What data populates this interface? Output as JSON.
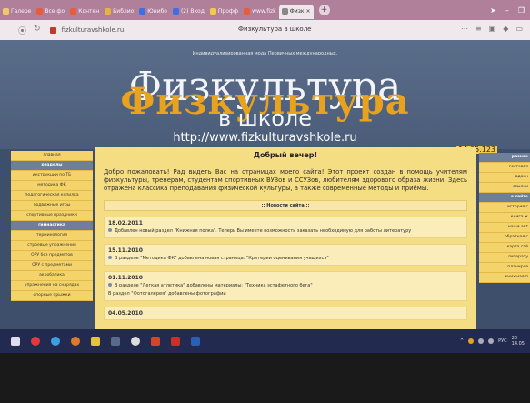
{
  "browser": {
    "tabs": [
      {
        "label": "Галере",
        "active": false
      },
      {
        "label": "Все фо",
        "active": false
      },
      {
        "label": "Контен",
        "active": false
      },
      {
        "label": "Библио",
        "active": false
      },
      {
        "label": "Юнибо",
        "active": false
      },
      {
        "label": "(2) Вход",
        "active": false
      },
      {
        "label": "Профф",
        "active": false
      },
      {
        "label": "www.fizk",
        "active": false
      },
      {
        "label": "Физк",
        "active": true
      }
    ],
    "new_tab": "+",
    "address": "fizkulturavshkole.ru",
    "page_title": "Физкультура в школе"
  },
  "site": {
    "top_note": "Индивидуализированная мода Первичных международных.",
    "brand_main": "Физкультура",
    "brand_overlay": "Физкультура",
    "brand_sub": "в школе",
    "url": "http://www.fizkulturavshkole.ru",
    "date": "14.05.123",
    "greeting": "Добрый вечер!",
    "welcome": "Добро пожаловать! Рад видеть Вас на страницах моего сайта! Этот проект создан в помощь учителям физкультуры, тренерам, студентам спортивных ВУЗов и ССУЗов, любителям здорового образа жизни. Здесь отражена классика преподавания физической культуры, а также современные методы и приёмы.",
    "news_header": ":: Новости сайта ::",
    "news": [
      {
        "date": "18.02.2011",
        "text": "Добавлен новый раздел \"Книжная полка\". Теперь Вы имеете возможность заказать необходимую для работы литературу"
      },
      {
        "date": "15.11.2010",
        "text": "В разделе \"Методика ФК\" добавлена новая страница: \"Критерии оценивания учащихся\""
      },
      {
        "date": "01.11.2010",
        "text": "В разделе \"Легкая атлетика\" добавлены материалы: \"Техника эстафетного бега\"",
        "text2": "В раздел \"Фотогалерея\" добавлены фотографии"
      },
      {
        "date": "04.05.2010",
        "text": ""
      }
    ],
    "left_nav": [
      {
        "label": "главная",
        "header": false
      },
      {
        "label": "разделы",
        "header": true
      },
      {
        "label": "инструкции по ТБ",
        "header": false
      },
      {
        "label": "методика ФК",
        "header": false
      },
      {
        "label": "педагогическая копилка",
        "header": false
      },
      {
        "label": "подвижные игры",
        "header": false
      },
      {
        "label": "спортивные праздники",
        "header": false
      },
      {
        "label": "гимнастика",
        "header": true
      },
      {
        "label": "терминология",
        "header": false
      },
      {
        "label": "строевые упражнения",
        "header": false
      },
      {
        "label": "ОРУ без предметов",
        "header": false
      },
      {
        "label": "ОРУ с предметами",
        "header": false
      },
      {
        "label": "акробатика",
        "header": false
      },
      {
        "label": "упражнения на снарядах",
        "header": false
      },
      {
        "label": "опорные прыжки",
        "header": false
      }
    ],
    "right_nav": [
      {
        "label": "разное",
        "header": true
      },
      {
        "label": "гостевая",
        "header": false
      },
      {
        "label": "вдохн",
        "header": false
      },
      {
        "label": "ссылки",
        "header": false
      },
      {
        "label": "о сайте",
        "header": true
      },
      {
        "label": "история с",
        "header": false
      },
      {
        "label": "книга ж",
        "header": false
      },
      {
        "label": "наши авт",
        "header": false
      },
      {
        "label": "обратная с",
        "header": false
      },
      {
        "label": "карта сай",
        "header": false
      },
      {
        "label": "литерату",
        "header": false
      },
      {
        "label": "планиров",
        "header": false
      },
      {
        "label": "книжная п",
        "header": false
      }
    ]
  },
  "taskbar": {
    "lang": "РУС",
    "time": "20",
    "date": "14.05"
  },
  "colors": {
    "tab_bar": "#b07f9a",
    "site_bg": "#3d4f6b",
    "content_bg": "#f5dd84",
    "brand_orange": "#e8a21d",
    "taskbar": "#232a4f"
  }
}
